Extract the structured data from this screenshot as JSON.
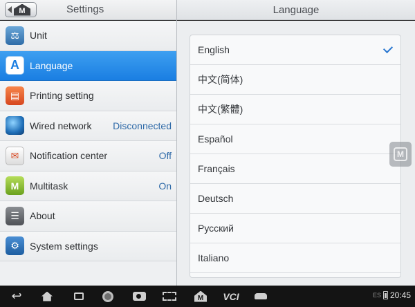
{
  "left_header": {
    "title": "Settings",
    "home_icon_letter": "M"
  },
  "right_header": {
    "title": "Language"
  },
  "settings": [
    {
      "label": "Unit",
      "value": "",
      "icon": "scale-icon",
      "icon_glyph": "⚖",
      "selected": false
    },
    {
      "label": "Language",
      "value": "",
      "icon": "language-icon",
      "icon_glyph": "A",
      "selected": true
    },
    {
      "label": "Printing setting",
      "value": "",
      "icon": "printer-icon",
      "icon_glyph": "▤",
      "selected": false
    },
    {
      "label": "Wired network",
      "value": "Disconnected",
      "icon": "globe-icon",
      "icon_glyph": "",
      "selected": false
    },
    {
      "label": "Notification center",
      "value": "Off",
      "icon": "notification-icon",
      "icon_glyph": "✉",
      "selected": false
    },
    {
      "label": "Multitask",
      "value": "On",
      "icon": "multitask-icon",
      "icon_glyph": "M",
      "selected": false
    },
    {
      "label": "About",
      "value": "",
      "icon": "about-icon",
      "icon_glyph": "☰",
      "selected": false
    },
    {
      "label": "System settings",
      "value": "",
      "icon": "gear-icon",
      "icon_glyph": "⚙",
      "selected": false
    }
  ],
  "languages": [
    {
      "label": "English",
      "checked": true
    },
    {
      "label": "中文(简体)",
      "checked": false
    },
    {
      "label": "中文(繁體)",
      "checked": false
    },
    {
      "label": "Español",
      "checked": false
    },
    {
      "label": "Français",
      "checked": false
    },
    {
      "label": "Deutsch",
      "checked": false
    },
    {
      "label": "Русский",
      "checked": false
    },
    {
      "label": "Italiano",
      "checked": false
    }
  ],
  "floating_button": {
    "letter": "M"
  },
  "navbar": {
    "vci_label": "VCI",
    "mhome_letter": "M"
  },
  "status": {
    "small_text": "ES",
    "time": "20:45"
  },
  "colors": {
    "selected_bg": "#1a7ee2",
    "value_text": "#2f6aa8",
    "check": "#2b78d0"
  }
}
